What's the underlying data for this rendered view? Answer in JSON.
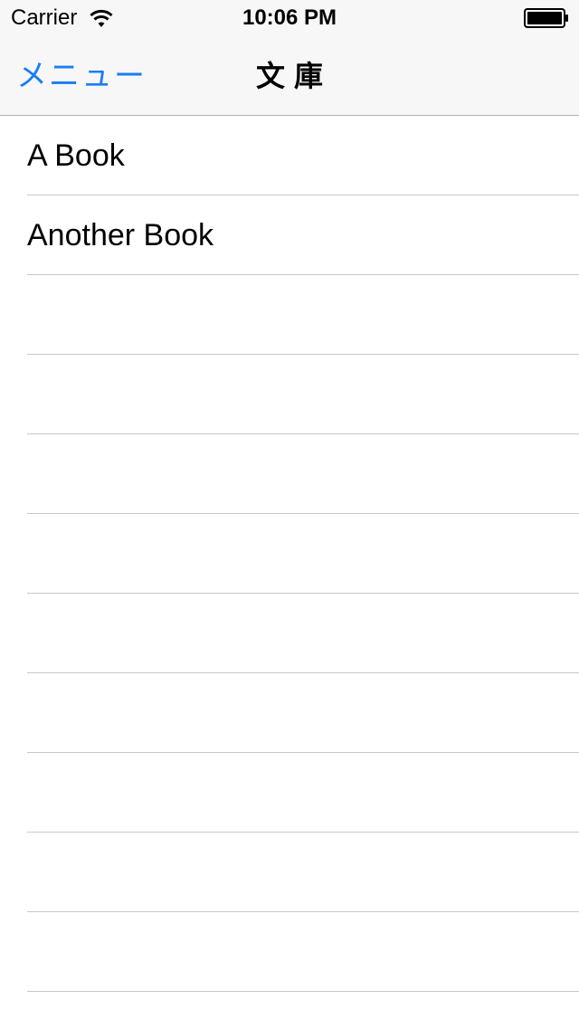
{
  "status_bar": {
    "carrier": "Carrier",
    "time": "10:06 PM",
    "wifi_icon": "wifi-icon",
    "battery_icon": "battery-full-icon"
  },
  "nav_bar": {
    "back_label": "メニュー",
    "title": "文庫"
  },
  "colors": {
    "accent": "#1a7cf5",
    "bar_background": "#f7f7f7",
    "separator": "#c8c7cc"
  },
  "table": {
    "rows": [
      {
        "label": "A Book"
      },
      {
        "label": "Another Book"
      },
      {
        "label": ""
      },
      {
        "label": ""
      },
      {
        "label": ""
      },
      {
        "label": ""
      },
      {
        "label": ""
      },
      {
        "label": ""
      },
      {
        "label": ""
      },
      {
        "label": ""
      },
      {
        "label": ""
      },
      {
        "label": ""
      }
    ]
  }
}
